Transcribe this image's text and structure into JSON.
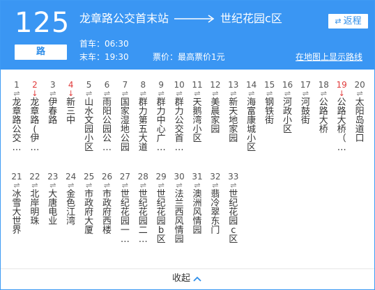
{
  "header": {
    "route_number": "125",
    "route_suffix": "路",
    "from": "龙章路公交首末站",
    "to": "世纪花园c区",
    "return_label": "返程",
    "first_bus": "首车：06:30",
    "last_bus": "末车：19:30",
    "price": "票价：最高票价1元",
    "map_link": "在地图上显示路线"
  },
  "stops": [
    {
      "num": "1",
      "name": "龙章路公交…",
      "highlight": false
    },
    {
      "num": "2",
      "name": "龙章路(伊…",
      "highlight": true
    },
    {
      "num": "3",
      "name": "伊春路",
      "highlight": false
    },
    {
      "num": "4",
      "name": "新三中",
      "highlight": true
    },
    {
      "num": "5",
      "name": "山水文园小区",
      "highlight": false
    },
    {
      "num": "6",
      "name": "雨阳公园公…",
      "highlight": false
    },
    {
      "num": "7",
      "name": "国家湿地公园",
      "highlight": false
    },
    {
      "num": "8",
      "name": "群力第五大道",
      "highlight": false
    },
    {
      "num": "9",
      "name": "群力中心广…",
      "highlight": false
    },
    {
      "num": "10",
      "name": "群力公交首…",
      "highlight": false
    },
    {
      "num": "11",
      "name": "天鹅湾小区",
      "highlight": false
    },
    {
      "num": "12",
      "name": "美晨家园",
      "highlight": false
    },
    {
      "num": "13",
      "name": "新天地家园",
      "highlight": false
    },
    {
      "num": "14",
      "name": "海富康城小区",
      "highlight": false
    },
    {
      "num": "15",
      "name": "钢铁街",
      "highlight": false
    },
    {
      "num": "16",
      "name": "河政小区",
      "highlight": false
    },
    {
      "num": "17",
      "name": "河鼓街",
      "highlight": false
    },
    {
      "num": "18",
      "name": "公路大桥",
      "highlight": false
    },
    {
      "num": "19",
      "name": "公路大桥（…",
      "highlight": true
    },
    {
      "num": "20",
      "name": "太阳岛道口",
      "highlight": false
    },
    {
      "num": "21",
      "name": "冰雪大世界",
      "highlight": false
    },
    {
      "num": "22",
      "name": "北岸明珠",
      "highlight": false
    },
    {
      "num": "23",
      "name": "大唐电业",
      "highlight": false
    },
    {
      "num": "24",
      "name": "金色江湾",
      "highlight": false
    },
    {
      "num": "25",
      "name": "市政府大厦",
      "highlight": false
    },
    {
      "num": "26",
      "name": "市政府西楼",
      "highlight": false
    },
    {
      "num": "27",
      "name": "世纪花园一…",
      "highlight": false
    },
    {
      "num": "28",
      "name": "世纪花园二…",
      "highlight": false
    },
    {
      "num": "29",
      "name": "世纪花园b区",
      "highlight": false
    },
    {
      "num": "30",
      "name": "法兰西风情园",
      "highlight": false
    },
    {
      "num": "31",
      "name": "澳洲风情园",
      "highlight": false
    },
    {
      "num": "32",
      "name": "翡冷翠东门",
      "highlight": false
    },
    {
      "num": "33",
      "name": "世纪花园c区",
      "highlight": false
    }
  ],
  "stop_marker": "⇌",
  "footer": {
    "collapse_label": "收起"
  },
  "colors": {
    "header_bg": "#3a96f3",
    "accent": "#2f8ee9",
    "highlight": "#e03b3b"
  }
}
